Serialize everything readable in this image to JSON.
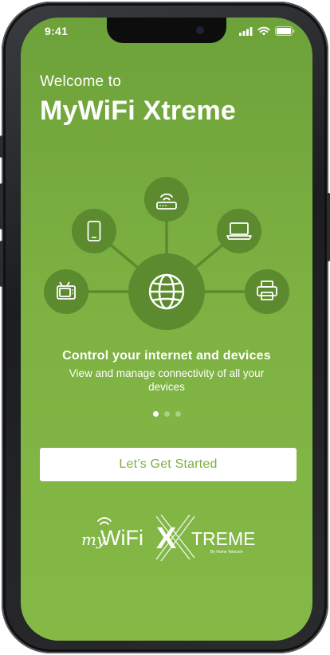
{
  "status_bar": {
    "time": "9:41",
    "icons": [
      "cellular-signal-icon",
      "wifi-icon",
      "battery-icon"
    ]
  },
  "onboarding": {
    "welcome": "Welcome to",
    "app_name": "MyWiFi Xtreme",
    "slide": {
      "heading": "Control your internet and devices",
      "description": "View and manage connectivity of all your devices"
    },
    "page_indicator": {
      "total": 3,
      "active": 1
    },
    "cta_label": "Let’s Get Started"
  },
  "diagram": {
    "center_icon": "globe-icon",
    "device_icons": [
      "tv-icon",
      "smartphone-icon",
      "router-icon",
      "laptop-icon",
      "printer-icon"
    ]
  },
  "logo": {
    "text_my": "my",
    "text_wifi": "WiFi",
    "text_x": "X",
    "text_treme": "TREME",
    "tagline": "By Home Telecom"
  },
  "colors": {
    "background_top": "#6da23a",
    "background_bottom": "#85b946",
    "node_fill": "#5c8a2e",
    "button_text": "#7fae45"
  }
}
